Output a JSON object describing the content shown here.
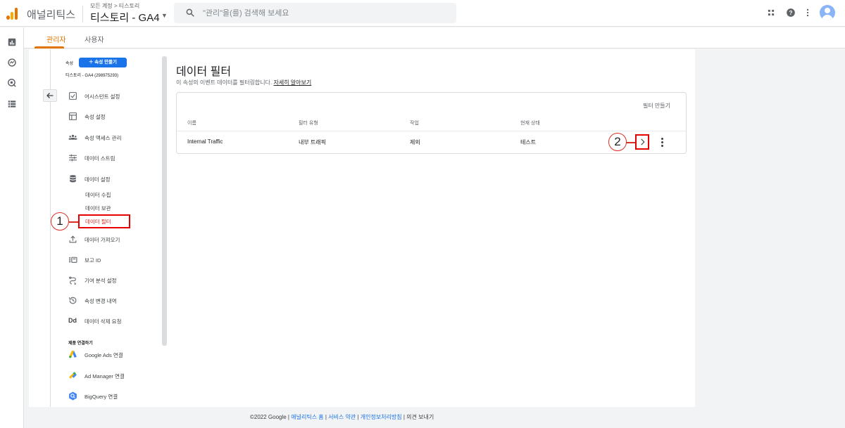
{
  "header": {
    "app_name": "애널리틱스",
    "breadcrumb": "모든 계정 > 티스토리",
    "property": "티스토리 - GA4",
    "search_placeholder": "\"관리\"을(를) 검색해 보세요"
  },
  "tabs": [
    {
      "label": "관리자",
      "active": true
    },
    {
      "label": "사용자",
      "active": false
    }
  ],
  "admin_nav": {
    "section_label": "속성",
    "create_button": "속성 만들기",
    "property_id": "티스토리 - GA4 (298975293)",
    "items": [
      {
        "label": "어시스턴트 설정",
        "icon": "checklist-icon"
      },
      {
        "label": "속성 설정",
        "icon": "property-settings-icon"
      },
      {
        "label": "속성 액세스 관리",
        "icon": "people-icon"
      },
      {
        "label": "데이터 스트림",
        "icon": "data-stream-icon"
      },
      {
        "label": "데이터 설정",
        "icon": "database-icon"
      }
    ],
    "sub_items": [
      {
        "label": "데이터 수집",
        "active": false
      },
      {
        "label": "데이터 보관",
        "active": false
      },
      {
        "label": "데이터 필터",
        "active": true
      }
    ],
    "items2": [
      {
        "label": "데이터 가져오기",
        "icon": "upload-icon"
      },
      {
        "label": "보고 ID",
        "icon": "reporting-id-icon"
      },
      {
        "label": "기여 분석 설정",
        "icon": "attribution-icon"
      },
      {
        "label": "속성 변경 내역",
        "icon": "history-icon"
      },
      {
        "label": "데이터 삭제 요청",
        "icon": "data-deletion-icon"
      }
    ],
    "products_title": "제품 연결하기",
    "products": [
      {
        "label": "Google Ads 연결",
        "icon": "google-ads-icon"
      },
      {
        "label": "Ad Manager 연결",
        "icon": "ad-manager-icon"
      },
      {
        "label": "BigQuery 연결",
        "icon": "bigquery-icon"
      }
    ]
  },
  "callouts": {
    "one": "1",
    "two": "2"
  },
  "main": {
    "title": "데이터 필터",
    "description": "이 속성의 이벤트 데이터를 필터링합니다.",
    "learn_more": "자세히 알아보기",
    "create_filter": "필터 만들기",
    "columns": [
      "이름",
      "필터 유형",
      "작업",
      "현재 상태"
    ],
    "rows": [
      {
        "name": "Internal Traffic",
        "type": "내부 트래픽",
        "action": "제외",
        "status": "테스트"
      }
    ]
  },
  "footer": {
    "copyright": "©2022 Google |",
    "home": "애널리틱스 홈",
    "terms": "서비스 약관",
    "privacy": "개인정보처리방침",
    "feedback": "의견 보내기"
  },
  "colors": {
    "accent": "#e37400",
    "primary": "#1a73e8",
    "highlight": "#e60000"
  }
}
